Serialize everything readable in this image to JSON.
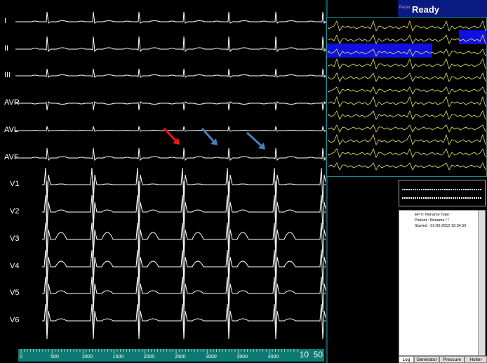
{
  "main_leads": [
    "I",
    "II",
    "III",
    "AVR",
    "AVL",
    "AVF",
    "V1",
    "V2",
    "V3",
    "V4",
    "V5",
    "V6"
  ],
  "ruler": {
    "ticks": [
      "0",
      "500",
      "1000",
      "1500",
      "2000",
      "2500",
      "3000",
      "3500",
      "4000"
    ],
    "gain": "10",
    "speed": "50"
  },
  "status": {
    "pacer": "Pacer",
    "state": "Ready"
  },
  "info": {
    "line1": "EP #: Noname    Type :",
    "line2": "Patient : Noname / /",
    "line3": "Started : 01-05-2012  19:34:50"
  },
  "tabs": [
    "Log",
    "Generator",
    "Pressure",
    "Holter"
  ],
  "colors": {
    "trace": "#ffffff",
    "mini_trace": "#e8e860",
    "arrow_red": "#e81818",
    "arrow_blue": "#4a7fb8",
    "highlight": "#1010e0"
  }
}
